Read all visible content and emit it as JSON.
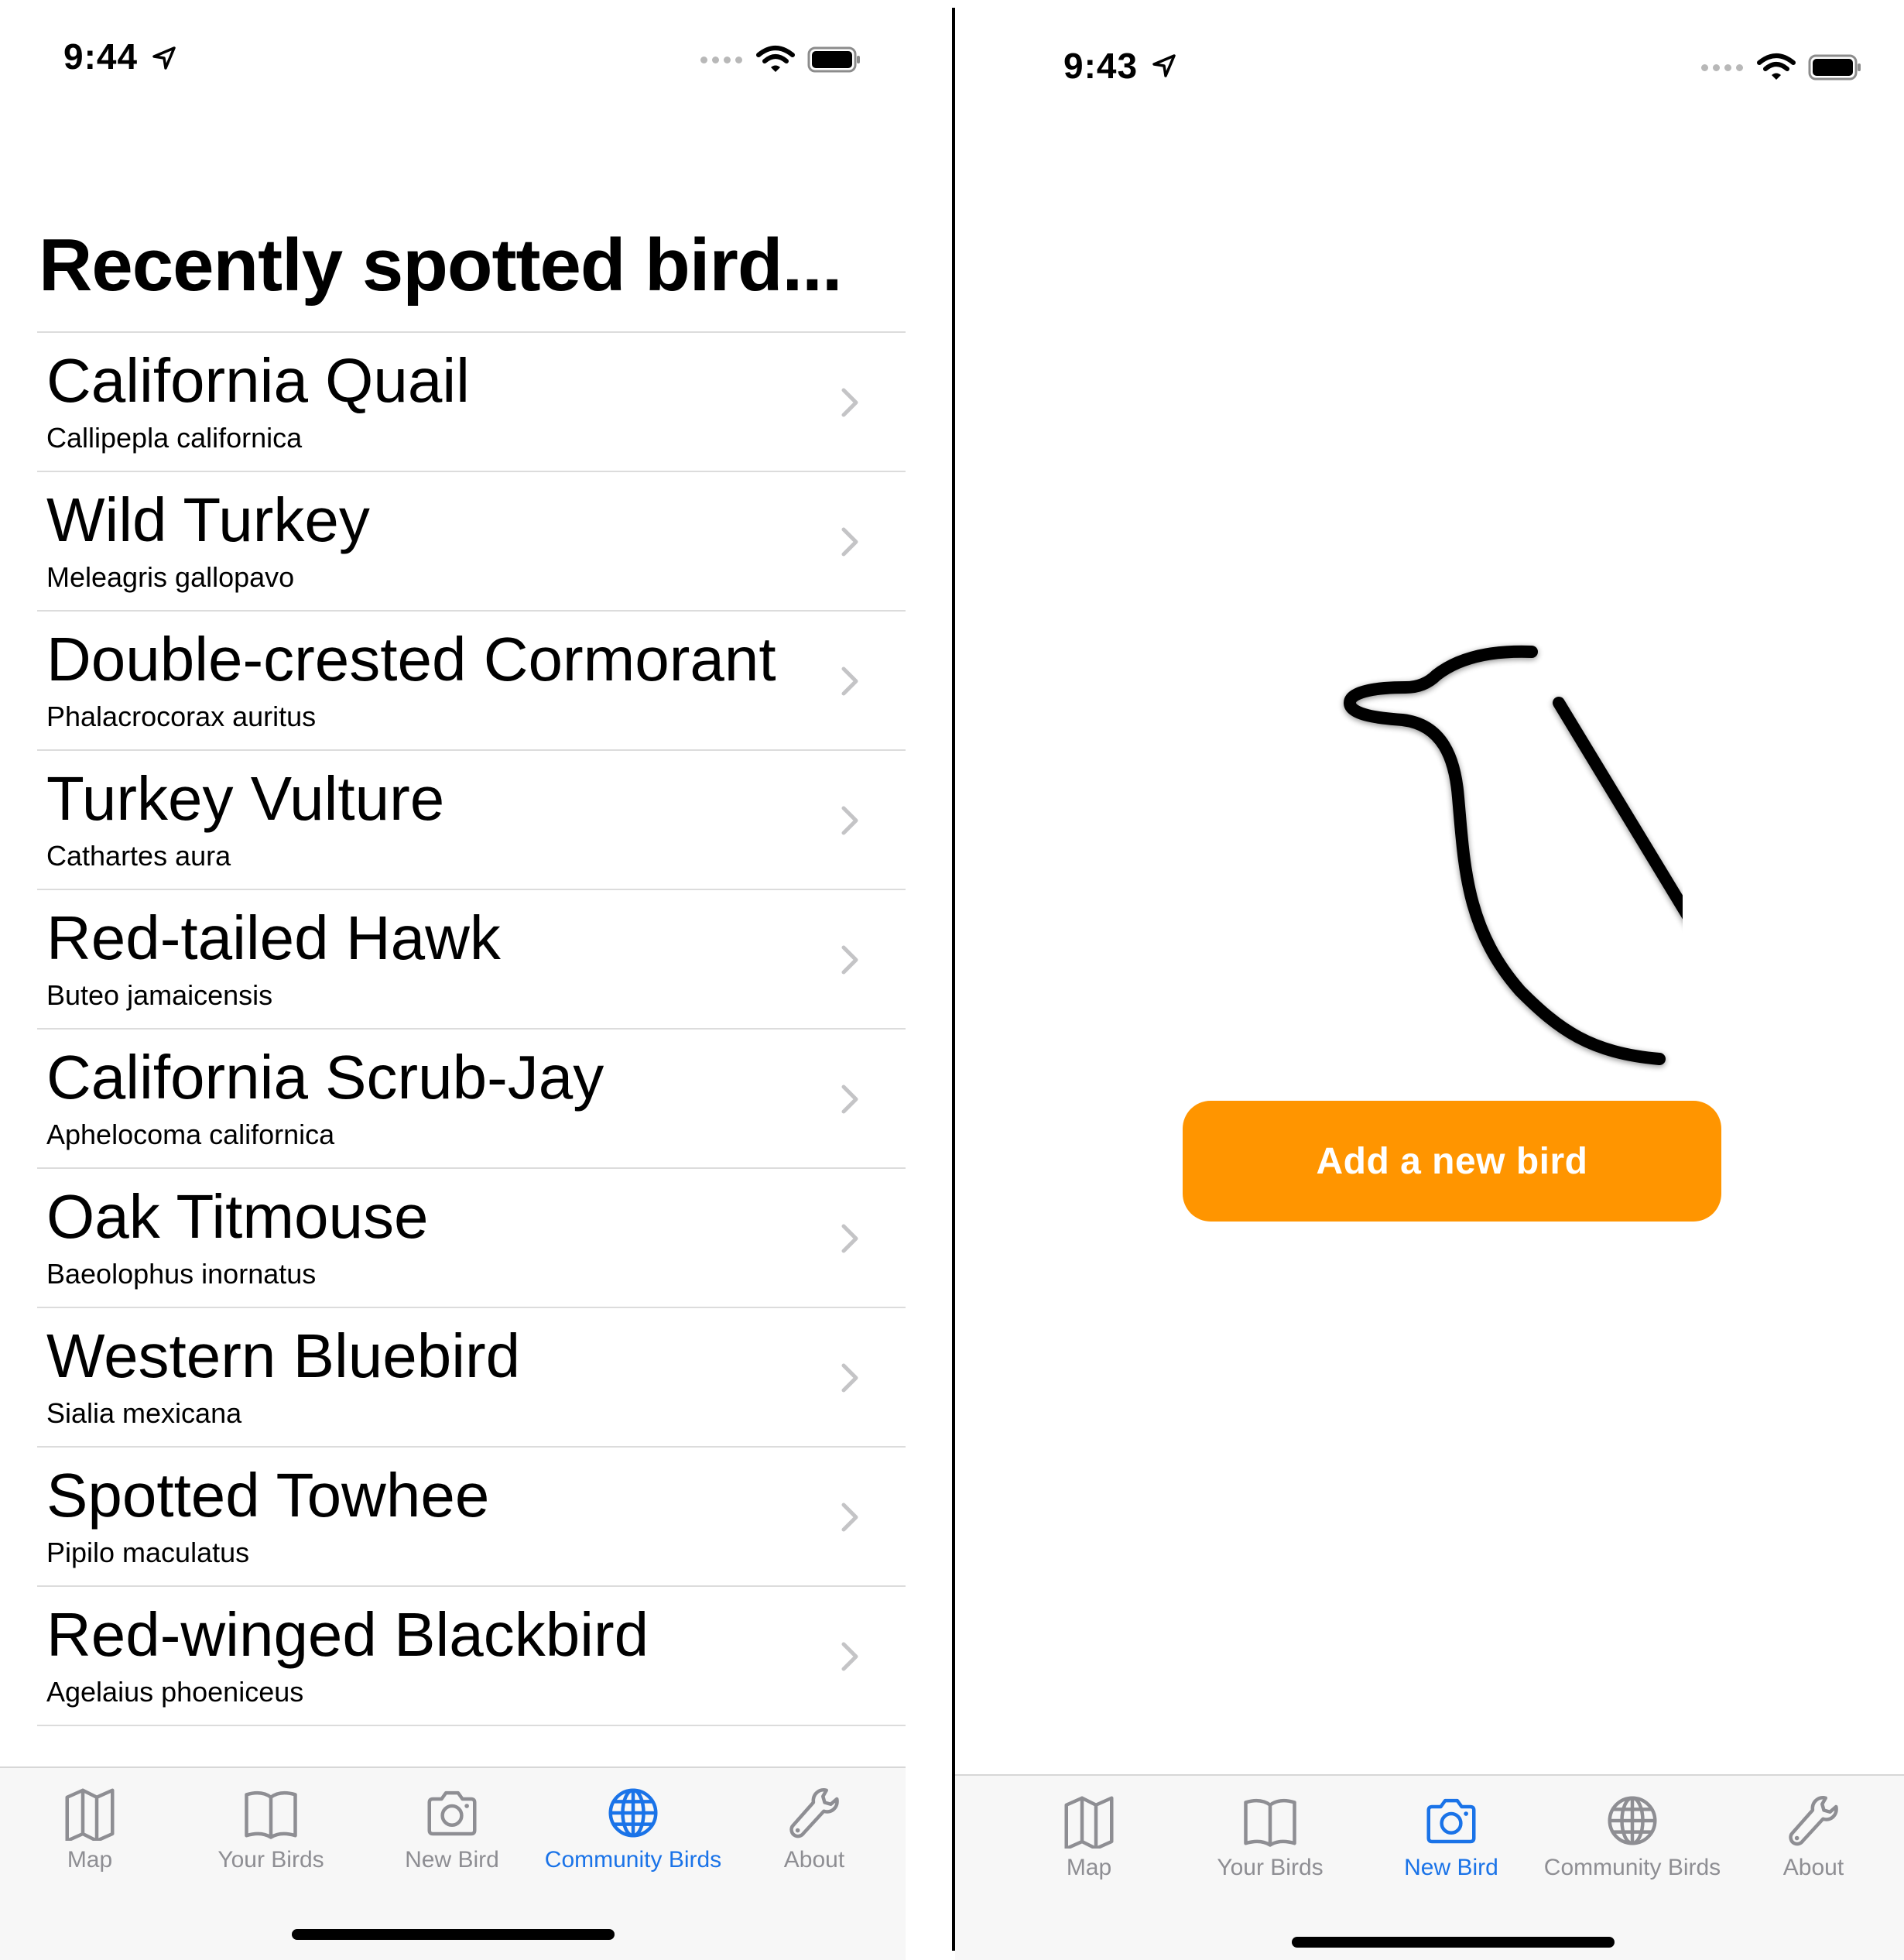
{
  "left": {
    "status": {
      "time": "9:44"
    },
    "title": "Recently spotted bird...",
    "birds": [
      {
        "common": "California Quail",
        "scientific": "Callipepla californica"
      },
      {
        "common": "Wild Turkey",
        "scientific": "Meleagris gallopavo"
      },
      {
        "common": "Double-crested Cormorant",
        "scientific": "Phalacrocorax auritus"
      },
      {
        "common": "Turkey Vulture",
        "scientific": "Cathartes aura"
      },
      {
        "common": "Red-tailed Hawk",
        "scientific": "Buteo jamaicensis"
      },
      {
        "common": "California Scrub-Jay",
        "scientific": "Aphelocoma californica"
      },
      {
        "common": "Oak Titmouse",
        "scientific": "Baeolophus inornatus"
      },
      {
        "common": "Western Bluebird",
        "scientific": "Sialia mexicana"
      },
      {
        "common": "Spotted Towhee",
        "scientific": "Pipilo maculatus"
      },
      {
        "common": "Red-winged Blackbird",
        "scientific": "Agelaius phoeniceus"
      }
    ],
    "tabs": [
      {
        "label": "Map",
        "icon": "map-icon"
      },
      {
        "label": "Your Birds",
        "icon": "book-icon"
      },
      {
        "label": "New Bird",
        "icon": "camera-icon"
      },
      {
        "label": "Community Birds",
        "icon": "globe-icon",
        "active": true
      },
      {
        "label": "About",
        "icon": "wrench-icon"
      }
    ]
  },
  "right": {
    "status": {
      "time": "9:43"
    },
    "illustration": "bird-outline-icon",
    "add_button_label": "Add a new bird",
    "tabs": [
      {
        "label": "Map",
        "icon": "map-icon"
      },
      {
        "label": "Your Birds",
        "icon": "book-icon"
      },
      {
        "label": "New Bird",
        "icon": "camera-icon",
        "active": true
      },
      {
        "label": "Community Birds",
        "icon": "globe-icon"
      },
      {
        "label": "About",
        "icon": "wrench-icon"
      }
    ]
  },
  "colors": {
    "accent": "#1a73e8",
    "button": "#ff9500",
    "inactive_tab": "#8e8e93",
    "separator": "#dcdcdc"
  }
}
